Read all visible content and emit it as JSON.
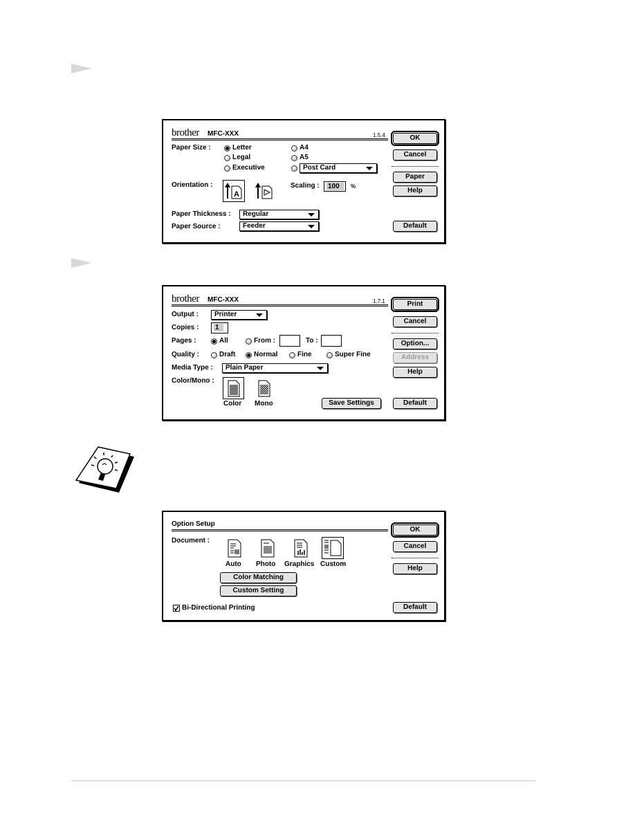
{
  "dialog1": {
    "brand": "brother",
    "model": "MFC-XXX",
    "version": "1.5.4",
    "buttons": {
      "ok": "OK",
      "cancel": "Cancel",
      "paper": "Paper",
      "help": "Help",
      "default": "Default"
    },
    "paper_size_label": "Paper Size :",
    "paper_sizes": [
      "Letter",
      "Legal",
      "Executive",
      "A4",
      "A5"
    ],
    "selected_paper_size": "Letter",
    "other_size_value": "Post Card",
    "orientation_label": "Orientation :",
    "selected_orientation": "portrait",
    "scaling_label": "Scaling :",
    "scaling_value": "100",
    "scaling_unit": "%",
    "paper_thickness_label": "Paper Thickness :",
    "paper_thickness_value": "Regular",
    "paper_source_label": "Paper Source :",
    "paper_source_value": "Feeder"
  },
  "dialog2": {
    "brand": "brother",
    "model": "MFC-XXX",
    "version": "1.7.1",
    "buttons": {
      "print": "Print",
      "cancel": "Cancel",
      "option": "Option...",
      "address": "Address",
      "help": "Help",
      "default": "Default",
      "save_settings": "Save Settings"
    },
    "output_label": "Output :",
    "output_value": "Printer",
    "copies_label": "Copies :",
    "copies_value": "1",
    "pages_label": "Pages :",
    "pages_all": "All",
    "pages_from": "From :",
    "pages_to": "To :",
    "pages_from_value": "",
    "pages_to_value": "",
    "selected_pages": "All",
    "quality_label": "Quality :",
    "quality_options": [
      "Draft",
      "Normal",
      "Fine",
      "Super Fine"
    ],
    "selected_quality": "Normal",
    "media_type_label": "Media Type :",
    "media_type_value": "Plain Paper",
    "color_mono_label": "Color/Mono :",
    "color_label": "Color",
    "mono_label": "Mono",
    "selected_color_mode": "Color"
  },
  "dialog3": {
    "title": "Option Setup",
    "buttons": {
      "ok": "OK",
      "cancel": "Cancel",
      "help": "Help",
      "default": "Default",
      "color_matching": "Color Matching",
      "custom_setting": "Custom Setting"
    },
    "document_label": "Document :",
    "document_types": [
      "Auto",
      "Photo",
      "Graphics",
      "Custom"
    ],
    "selected_document": "Custom",
    "bidirectional_label": "Bi-Directional Printing",
    "bidirectional_checked": true
  },
  "icons": {
    "step_marker": "triangle-arrow",
    "note": "lightbulb-icon"
  }
}
